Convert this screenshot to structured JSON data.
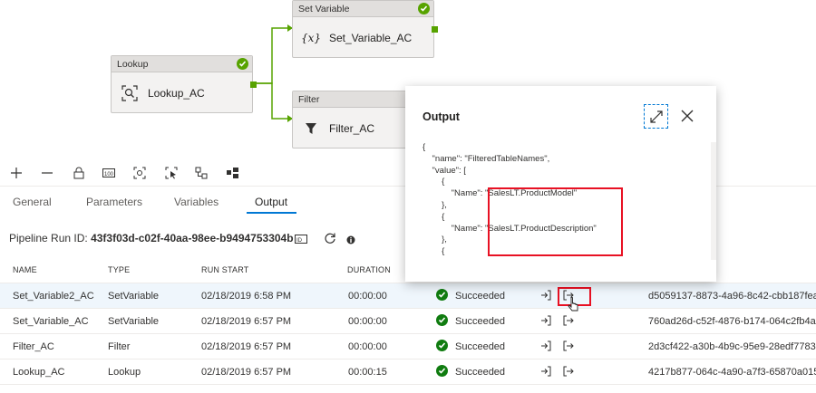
{
  "canvas": {
    "set_variable": {
      "header": "Set Variable",
      "icon": "{x}",
      "label": "Set_Variable_AC"
    },
    "lookup": {
      "header": "Lookup",
      "label": "Lookup_AC"
    },
    "filter": {
      "header": "Filter",
      "label": "Filter_AC"
    }
  },
  "toolbar": {
    "icons": [
      "plus-icon",
      "minus-icon",
      "lock-icon",
      "zoom-100-icon",
      "fit-to-screen-icon",
      "select-icon",
      "auto-align-icon",
      "layout-icon"
    ]
  },
  "tabs": [
    "General",
    "Parameters",
    "Variables",
    "Output"
  ],
  "active_tab": "Output",
  "run": {
    "label": "Pipeline Run ID:",
    "id": "43f3f03d-c02f-40aa-98ee-b9494753304b"
  },
  "table": {
    "headers": [
      "NAME",
      "TYPE",
      "RUN START",
      "DURATION"
    ],
    "rows": [
      {
        "name": "Set_Variable2_AC",
        "type": "SetVariable",
        "start": "02/18/2019 6:58 PM",
        "duration": "00:00:00",
        "status": "Succeeded",
        "run_id": "d5059137-8873-4a96-8c42-cbb187feae"
      },
      {
        "name": "Set_Variable_AC",
        "type": "SetVariable",
        "start": "02/18/2019 6:57 PM",
        "duration": "00:00:00",
        "status": "Succeeded",
        "run_id": "760ad26d-c52f-4876-b174-064c2fb4ae1"
      },
      {
        "name": "Filter_AC",
        "type": "Filter",
        "start": "02/18/2019 6:57 PM",
        "duration": "00:00:00",
        "status": "Succeeded",
        "run_id": "2d3cf422-a30b-4b9c-95e9-28edf7783c1"
      },
      {
        "name": "Lookup_AC",
        "type": "Lookup",
        "start": "02/18/2019 6:57 PM",
        "duration": "00:00:15",
        "status": "Succeeded",
        "run_id": "4217b877-064c-4a90-a7f3-65870a0155"
      }
    ]
  },
  "output_dialog": {
    "title": "Output",
    "json_text": "{\n    \"name\": \"FilteredTableNames\",\n    \"value\": [\n        {\n            \"Name\": \"SalesLT.ProductModel\"\n        },\n        {\n            \"Name\": \"SalesLT.ProductDescription\"\n        },\n        {"
  },
  "colors": {
    "success": "#57a300",
    "accent": "#0078d4",
    "highlight": "#e81123"
  }
}
